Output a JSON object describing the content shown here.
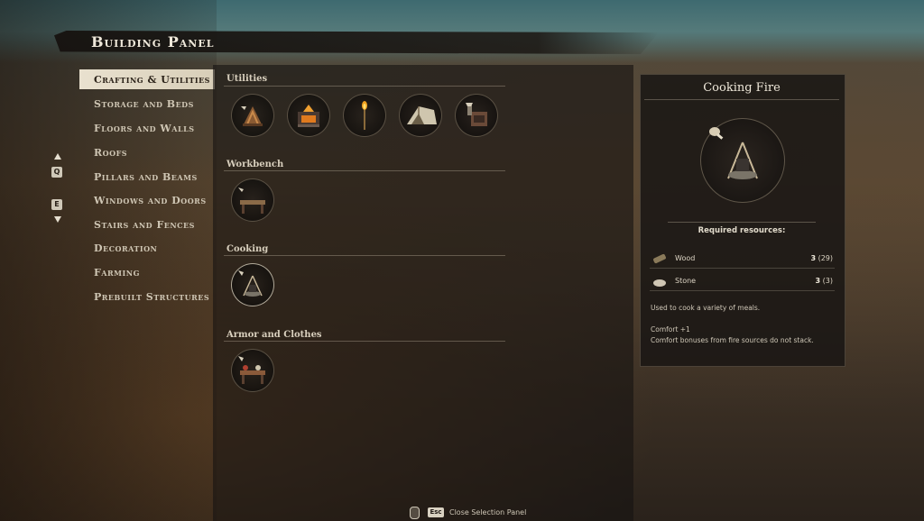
{
  "header": {
    "title": "Building Panel"
  },
  "categories": {
    "items": [
      {
        "label": "Crafting & Utilities",
        "active": true
      },
      {
        "label": "Storage and Beds",
        "active": false
      },
      {
        "label": "Floors and Walls",
        "active": false
      },
      {
        "label": "Roofs",
        "active": false
      },
      {
        "label": "Pillars and Beams",
        "active": false
      },
      {
        "label": "Windows and Doors",
        "active": false
      },
      {
        "label": "Stairs and Fences",
        "active": false
      },
      {
        "label": "Decoration",
        "active": false
      },
      {
        "label": "Farming",
        "active": false
      },
      {
        "label": "Prebuilt Structures",
        "active": false
      }
    ],
    "key_up": "Q",
    "key_down": "E"
  },
  "sections": [
    {
      "title": "Utilities",
      "items": [
        {
          "icon": "campfire-logs-icon"
        },
        {
          "icon": "smelter-furnace-icon"
        },
        {
          "icon": "standing-torch-icon"
        },
        {
          "icon": "tent-icon"
        },
        {
          "icon": "stove-oven-icon"
        }
      ]
    },
    {
      "title": "Workbench",
      "items": [
        {
          "icon": "workbench-icon"
        }
      ]
    },
    {
      "title": "Cooking",
      "items": [
        {
          "icon": "cooking-fire-icon"
        }
      ]
    },
    {
      "title": "Armor and Clothes",
      "items": [
        {
          "icon": "tailoring-table-icon"
        }
      ]
    }
  ],
  "detail": {
    "title": "Cooking Fire",
    "icon": "cooking-fire-icon",
    "required_title": "Required resources:",
    "resources": [
      {
        "name": "Wood",
        "required": "3",
        "owned": "(29)",
        "icon": "wood-log-icon"
      },
      {
        "name": "Stone",
        "required": "3",
        "owned": "(3)",
        "icon": "stone-icon"
      }
    ],
    "description": "Used to cook a variety of meals.",
    "comfort": "Comfort +1",
    "comfort_note": "Comfort bonuses from fire sources do not stack."
  },
  "footer": {
    "key": "Esc",
    "label": "Close Selection Panel"
  },
  "colors": {
    "panel_bg": "#1a1714",
    "text": "#d9d2c2",
    "active_tab_bg": "#e9e1cf",
    "accent": "#efe8da"
  }
}
